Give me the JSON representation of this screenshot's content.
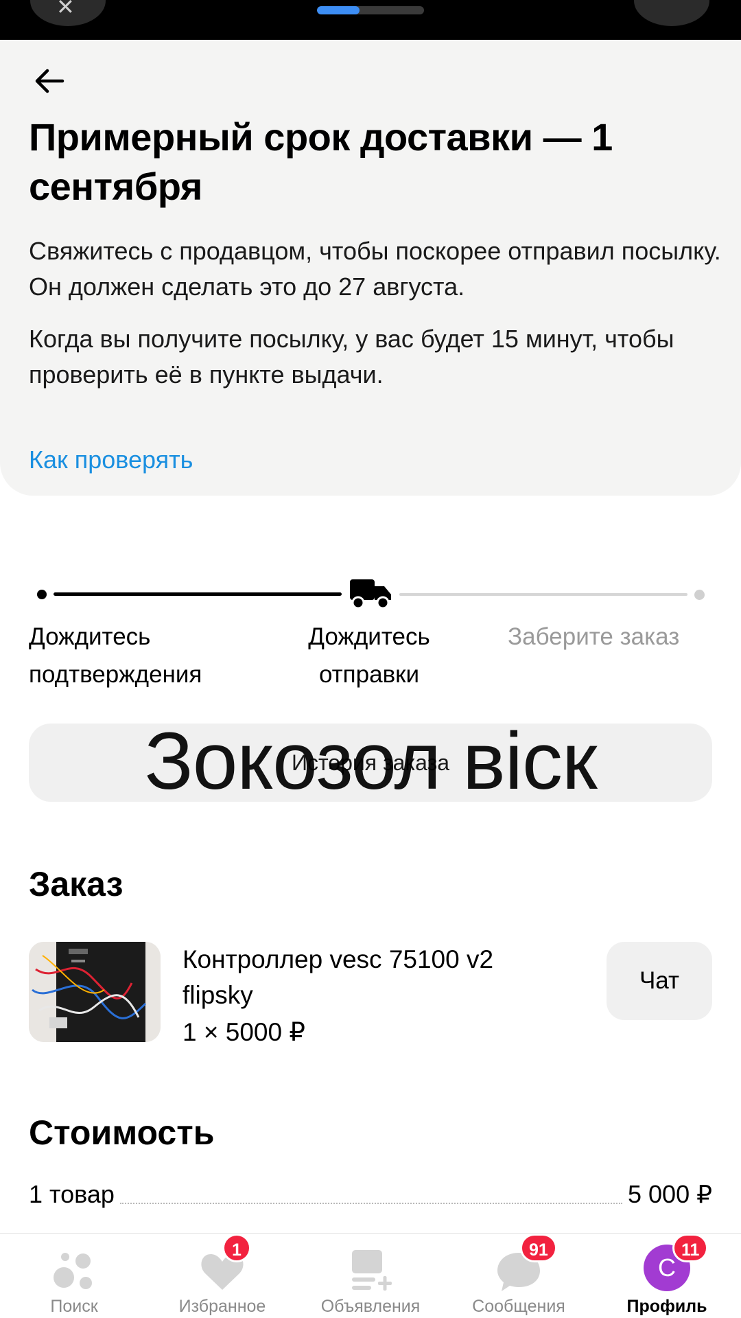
{
  "status_bar": {
    "loading_progress": 0.4,
    "progress_color": "#3d8ef5"
  },
  "header": {
    "back_icon": "arrow-left-icon",
    "title": "Примерный срок доставки — 1 сентября",
    "paragraph1": "Свяжитесь с продавцом, чтобы поскорее отправил посылку. Он должен сделать это до 27 августа.",
    "paragraph2": "Когда вы получите посылку, у вас будет 15 минут, чтобы проверить её в пункте выдачи.",
    "link": "Как проверять",
    "link_color": "#1a8fe0"
  },
  "stepper": {
    "steps": [
      {
        "label": "Дождитесь подтверждения",
        "state": "done"
      },
      {
        "label": "Дождитесь отправки",
        "state": "current",
        "icon": "truck-icon"
      },
      {
        "label": "Заберите заказ",
        "state": "pending"
      }
    ]
  },
  "history_button": {
    "label": "История заказа"
  },
  "overlay_caption": "Зокозол віск",
  "order": {
    "title": "Заказ",
    "product_name": "Контроллер vesc 75100 v2 flipsky",
    "product_price": "1 × 5000 ₽",
    "chat_label": "Чат"
  },
  "cost": {
    "title": "Стоимость",
    "row_label": "1 товар",
    "row_value": "5 000 ₽"
  },
  "tabbar": {
    "tabs": [
      {
        "label": "Поиск",
        "icon": "search-bubbles-icon"
      },
      {
        "label": "Избранное",
        "icon": "heart-icon",
        "badge": "1"
      },
      {
        "label": "Объявления",
        "icon": "listings-add-icon"
      },
      {
        "label": "Сообщения",
        "icon": "chat-bubble-icon",
        "badge": "91"
      },
      {
        "label": "Профиль",
        "icon": "avatar-icon",
        "badge": "11",
        "avatar_letter": "С",
        "active": true
      }
    ]
  },
  "colors": {
    "accent_blue": "#1a8fe0",
    "badge_red": "#f2223f",
    "avatar_purple": "#a23bd2"
  }
}
